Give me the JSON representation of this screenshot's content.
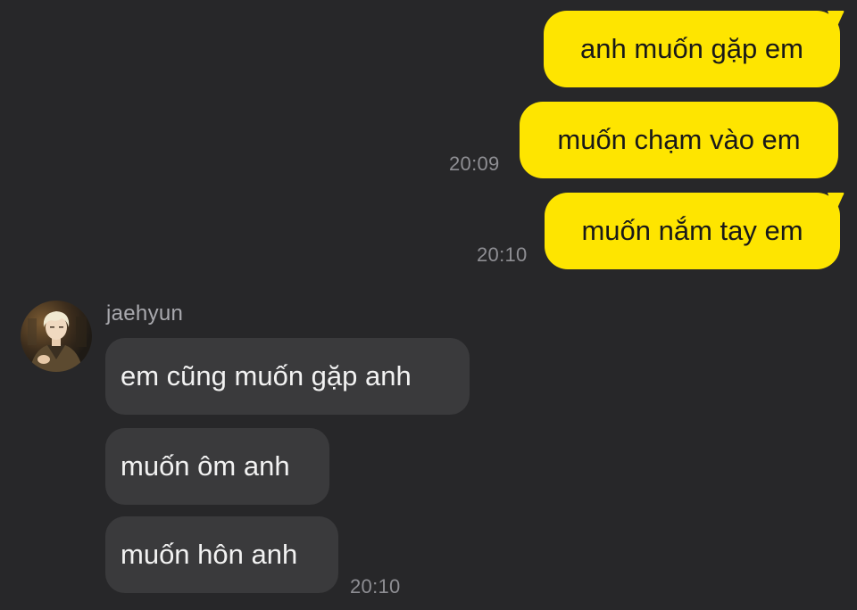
{
  "outgoing": [
    {
      "text": "anh muốn gặp em"
    },
    {
      "text": "muốn chạm vào em",
      "time": "20:09"
    },
    {
      "text": "muốn nắm tay em",
      "time": "20:10"
    }
  ],
  "contact": {
    "name": "jaehyun",
    "avatar_icon": "profile-photo"
  },
  "incoming": [
    {
      "text": "em cũng muốn gặp anh"
    },
    {
      "text": "muốn ôm anh"
    },
    {
      "text": "muốn hôn anh",
      "time": "20:10"
    }
  ],
  "colors": {
    "background": "#272729",
    "outgoing_bubble": "#fee500",
    "incoming_bubble": "#3a3a3c",
    "timestamp": "#8e8e93"
  }
}
